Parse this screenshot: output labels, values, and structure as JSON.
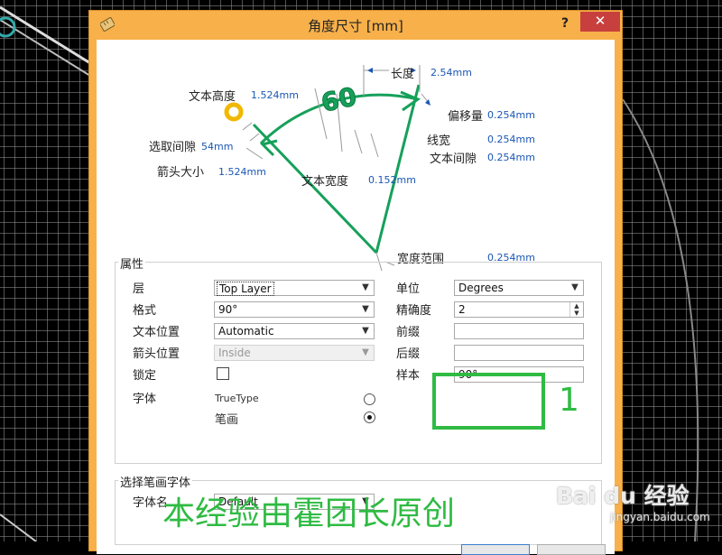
{
  "window": {
    "title": "角度尺寸 [mm]",
    "help_label": "?",
    "close_label": "✕"
  },
  "diagram": {
    "angle_text": "60",
    "labels": {
      "text_height": "文本高度",
      "text_height_value": "1.524mm",
      "length": "长度",
      "length_value": "2.54mm",
      "offset": "偏移量",
      "offset_value": "0.254mm",
      "line_width": "线宽",
      "line_width_value": "0.254mm",
      "text_gap": "文本间隙",
      "text_gap_value": "0.254mm",
      "pick_gap": "选取间隙",
      "pick_gap_value": "54mm",
      "arrow_size": "箭头大小",
      "arrow_size_value": "1.524mm",
      "text_width": "文本宽度",
      "text_width_value": "0.152mm",
      "extension_width": "宽度范围",
      "extension_width_value": "0.254mm"
    }
  },
  "properties": {
    "group_title": "属性",
    "layer_label": "层",
    "layer_value": "Top Layer",
    "format_label": "格式",
    "format_value": "90°",
    "text_position_label": "文本位置",
    "text_position_value": "Automatic",
    "arrow_position_label": "箭头位置",
    "arrow_position_value": "Inside",
    "lock_label": "锁定",
    "font_label": "字体",
    "font_truetype": "TrueType",
    "font_stroke": "笔画",
    "selected_font": "stroke",
    "unit_label": "单位",
    "unit_value": "Degrees",
    "precision_label": "精确度",
    "precision_value": "2",
    "prefix_label": "前缀",
    "prefix_value": "",
    "suffix_label": "后缀",
    "suffix_value": "",
    "sample_label": "样本",
    "sample_value": "90°"
  },
  "stroke_font": {
    "group_title": "选择笔画字体",
    "font_name_label": "字体名",
    "font_name_value": "Default"
  },
  "annotation": {
    "number": "1",
    "color": "#2fbb43"
  },
  "watermark": {
    "text": "本经验由霍团长原创",
    "logo_text": "Bai du 经验",
    "url": "jingyan.baidu.com"
  },
  "colors": {
    "dim_green": "#16a05a",
    "value_blue": "#1a56b4",
    "title_orange": "#f7b04a",
    "close_red": "#c8403e"
  }
}
